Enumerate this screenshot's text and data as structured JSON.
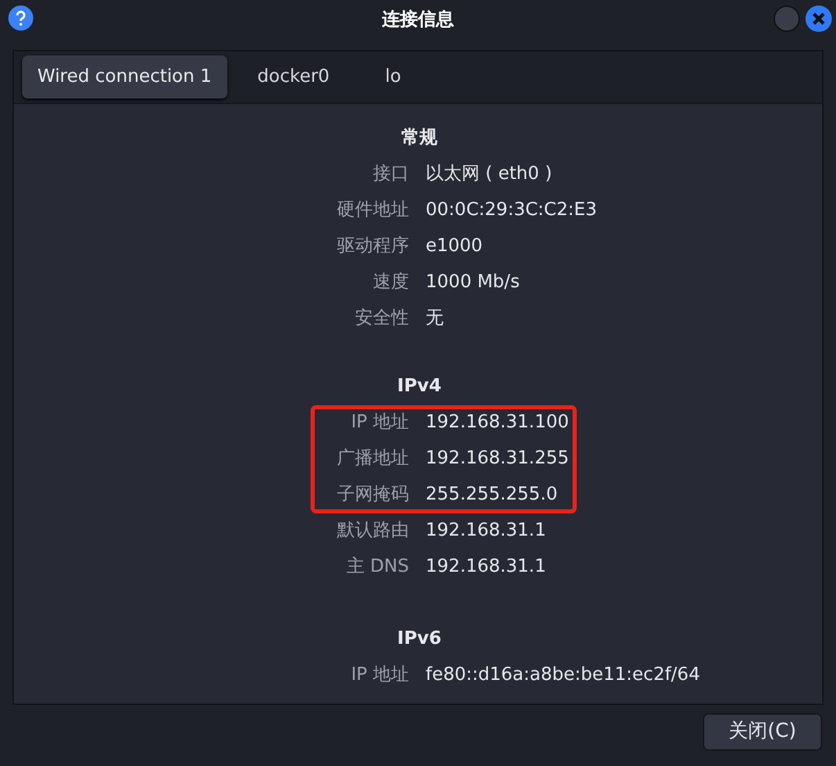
{
  "window": {
    "title": "连接信息"
  },
  "tabs": [
    {
      "label": "Wired connection 1",
      "selected": true
    },
    {
      "label": "docker0",
      "selected": false
    },
    {
      "label": "lo",
      "selected": false
    }
  ],
  "sections": [
    {
      "heading": "常规",
      "rows": [
        {
          "label": "接口",
          "value": "以太网 ( eth0 )",
          "highlighted": false
        },
        {
          "label": "硬件地址",
          "value": "00:0C:29:3C:C2:E3",
          "highlighted": false
        },
        {
          "label": "驱动程序",
          "value": "e1000",
          "highlighted": false
        },
        {
          "label": "速度",
          "value": "1000 Mb/s",
          "highlighted": false
        },
        {
          "label": "安全性",
          "value": "无",
          "highlighted": false
        }
      ]
    },
    {
      "heading": "IPv4",
      "rows": [
        {
          "label": "IP 地址",
          "value": "192.168.31.100",
          "highlighted": true
        },
        {
          "label": "广播地址",
          "value": "192.168.31.255",
          "highlighted": true
        },
        {
          "label": "子网掩码",
          "value": "255.255.255.0",
          "highlighted": true
        },
        {
          "label": "默认路由",
          "value": "192.168.31.1",
          "highlighted": false
        },
        {
          "label": "主 DNS",
          "value": "192.168.31.1",
          "highlighted": false
        }
      ]
    },
    {
      "heading": "IPv6",
      "rows": [
        {
          "label": "IP 地址",
          "value": "fe80::d16a:a8be:be11:ec2f/64",
          "highlighted": false
        }
      ]
    }
  ],
  "buttons": [
    {
      "label": "关闭(C)"
    }
  ]
}
